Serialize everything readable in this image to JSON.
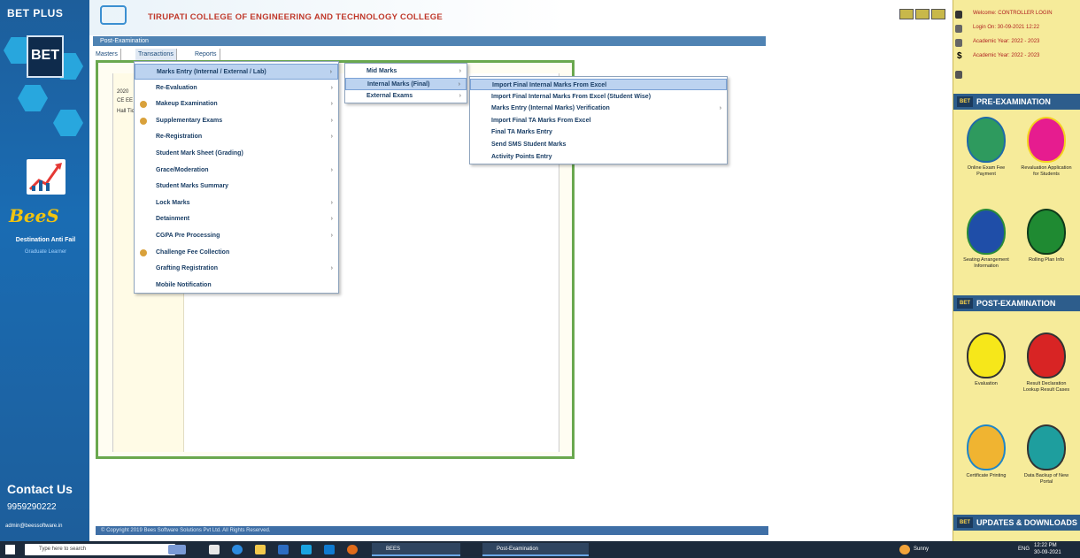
{
  "brand": {
    "product": "BET PLUS",
    "badge": "BET",
    "bees": "BeeS",
    "solution": "Destination Anti Fail",
    "solution_sub": "Graduate Learner",
    "contact_title": "Contact Us",
    "phone": "9959290222",
    "email": "admin@beessoftware.in"
  },
  "header": {
    "college_name": "TIRUPATI COLLEGE OF ENGINEERING AND TECHNOLOGY COLLEGE",
    "breadcrumb": "Post-Examination"
  },
  "menu": {
    "tabs": [
      "Masters",
      "Transactions",
      "Reports"
    ]
  },
  "main": {
    "left_strip": [
      "2020",
      "CE EE",
      "Hall Ticket"
    ]
  },
  "dropdown_l1": {
    "items": [
      {
        "label": "Marks Entry (Internal / External / Lab)",
        "has_sub": true,
        "dot": false,
        "highlighted": true
      },
      {
        "label": "Re-Evaluation",
        "has_sub": true,
        "dot": false
      },
      {
        "label": "Makeup Examination",
        "has_sub": true,
        "dot": true
      },
      {
        "label": "Supplementary Exams",
        "has_sub": true,
        "dot": true
      },
      {
        "label": "Re-Registration",
        "has_sub": true,
        "dot": false
      },
      {
        "label": "Student Mark Sheet (Grading)",
        "has_sub": false,
        "dot": false
      },
      {
        "label": "Grace/Moderation",
        "has_sub": true,
        "dot": false
      },
      {
        "label": "Student Marks Summary",
        "has_sub": false,
        "dot": false
      },
      {
        "label": "Lock Marks",
        "has_sub": true,
        "dot": false
      },
      {
        "label": "Detainment",
        "has_sub": true,
        "dot": false
      },
      {
        "label": "CGPA Pre Processing",
        "has_sub": true,
        "dot": false
      },
      {
        "label": "Challenge Fee Collection",
        "has_sub": false,
        "dot": true
      },
      {
        "label": "Grafting Registration",
        "has_sub": true,
        "dot": false
      },
      {
        "label": "Mobile Notification",
        "has_sub": false,
        "dot": false
      }
    ]
  },
  "dropdown_l2": {
    "items": [
      {
        "label": "Mid Marks",
        "highlighted": false
      },
      {
        "label": "Internal Marks (Final)",
        "highlighted": true
      },
      {
        "label": "External Exams",
        "highlighted": false
      }
    ]
  },
  "dropdown_l3": {
    "items": [
      {
        "label": "Import Final Internal Marks From Excel",
        "highlighted": true,
        "has_sub": false
      },
      {
        "label": "Import Final Internal Marks From Excel (Student Wise)",
        "highlighted": false,
        "has_sub": false
      },
      {
        "label": "Marks Entry (Internal Marks) Verification",
        "highlighted": false,
        "has_sub": true
      },
      {
        "label": "Import Final TA Marks From Excel",
        "highlighted": false,
        "has_sub": false
      },
      {
        "label": "Final TA Marks Entry",
        "highlighted": false,
        "has_sub": false
      },
      {
        "label": "Send SMS Student Marks",
        "highlighted": false,
        "has_sub": false
      },
      {
        "label": "Activity Points Entry",
        "highlighted": false,
        "has_sub": false
      }
    ]
  },
  "footer": {
    "copyright": "© Copyright 2019 Bees Software Solutions Pvt Ltd. All Rights Reserved."
  },
  "user_panel": {
    "lines": [
      "Welcome: CONTROLLER LOGIN",
      "Login On: 30-09-2021 12:22",
      "Academic Year: 2022 - 2023",
      "Academic Year: 2022 - 2023"
    ]
  },
  "right_sections": {
    "pre_exam": "PRE-EXAMINATION",
    "post_exam": "POST-EXAMINATION",
    "updates": "UPDATES & DOWNLOADS",
    "tiles_pre": [
      {
        "label": "Online Exam Fee Payment",
        "color": "#2e9a5e",
        "ring": "#1f6aa8"
      },
      {
        "label": "Revaluation Application for Students",
        "color": "#e61c8f",
        "ring": "#f4d21f"
      },
      {
        "label": "Seating Arrangement Information",
        "color": "#1f4ea8",
        "ring": "#2a8a3a"
      },
      {
        "label": "Rolling Plan Info",
        "color": "#1f8a32",
        "ring": "#0f3b1a"
      }
    ],
    "tiles_post": [
      {
        "label": "Evaluation",
        "color": "#f6e71a",
        "ring": "#333333"
      },
      {
        "label": "Result Declaration Lookup Result Cases",
        "color": "#d82424",
        "ring": "#333333"
      },
      {
        "label": "Certificate Printing",
        "color": "#f0b431",
        "ring": "#1e86c8"
      },
      {
        "label": "Data Backup of New Portal",
        "color": "#1e9e9e",
        "ring": "#333333"
      }
    ],
    "section_tag": "BET"
  },
  "taskbar": {
    "search_placeholder": "Type here to search",
    "apps": [
      "BEES",
      "Post-Examination"
    ],
    "tray": [
      "Sunny",
      "ENG",
      "12:22 PM",
      "30-09-2021"
    ]
  },
  "colors": {
    "sidebar_blue": "#1d5e9b",
    "right_panel": "#f6eb9a",
    "panel_green": "#6aa84f",
    "highlight": "#bcd3f0"
  }
}
